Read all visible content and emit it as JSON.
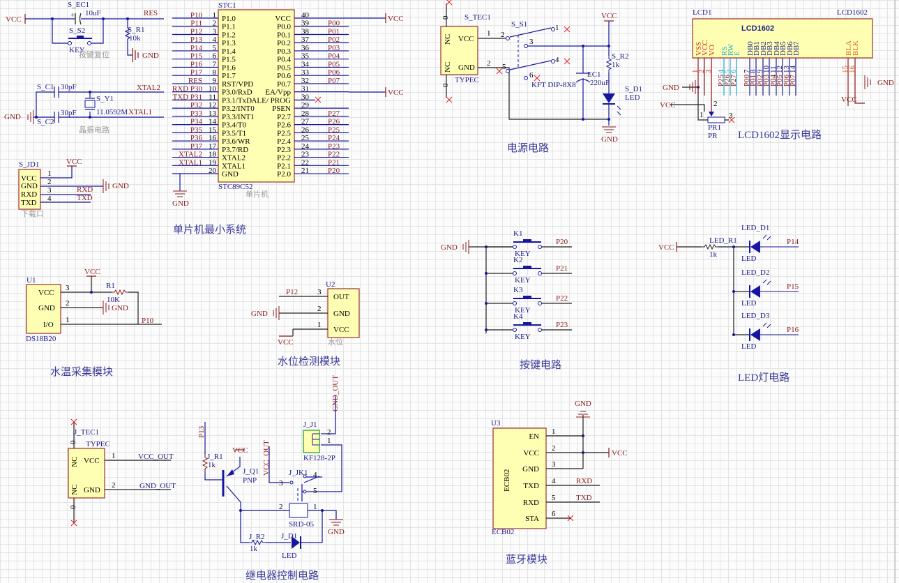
{
  "colors": {
    "wire": "#1616a0",
    "net": "#8b1a1a",
    "body": "#ffffb4",
    "body_border": "#a0302a",
    "caption": "#9a9a9a",
    "noconnect": "#e02020",
    "lcd_power": "#e02020",
    "lcd_ctrl": "#20a8c8",
    "lcd_data": "#20208c",
    "lcd_backlight": "#e06020"
  },
  "reset": {
    "vcc": "VCC",
    "cap_ref": "S_EC1",
    "cap_val": "10uF",
    "net": "RES",
    "sw_ref": "S_S2",
    "sw_val": "KEY",
    "caption": "按键复位",
    "r_ref": "S_R1",
    "r_val": "10k",
    "gnd": "GND"
  },
  "crystal": {
    "c1_ref": "S_C1",
    "c1_val": "30pF",
    "c2_ref": "S_C2",
    "c2_val": "30pF",
    "y_ref": "S_Y1",
    "y_val": "11.0592M",
    "net2": "XTAL2",
    "net1": "XTAL1",
    "gnd": "GND",
    "caption": "晶振电路"
  },
  "download": {
    "ref": "S_JD1",
    "vcc": "VCC",
    "gnd": "GND",
    "caption": "下载口",
    "pins": [
      {
        "num": "1",
        "name": "VCC",
        "net": ""
      },
      {
        "num": "2",
        "name": "GND",
        "net": ""
      },
      {
        "num": "3",
        "name": "RXD",
        "net": "RXD"
      },
      {
        "num": "4",
        "name": "TXD",
        "net": "TXD"
      }
    ]
  },
  "mcu": {
    "ref": "STC1",
    "part": "STC89C52",
    "caption": "单片机",
    "title": "单片机最小系统",
    "gnd": "GND",
    "vcc": "VCC",
    "vcc2": "VCC",
    "left_pins": [
      {
        "num": "1",
        "name": "P1.0",
        "net": "P10"
      },
      {
        "num": "2",
        "name": "P1.1",
        "net": "P11"
      },
      {
        "num": "3",
        "name": "P1.2",
        "net": "P12"
      },
      {
        "num": "4",
        "name": "P1.3",
        "net": "P13"
      },
      {
        "num": "5",
        "name": "P1.4",
        "net": "P14"
      },
      {
        "num": "6",
        "name": "P1.5",
        "net": "P15"
      },
      {
        "num": "7",
        "name": "P1.6",
        "net": "P16"
      },
      {
        "num": "8",
        "name": "P1.7",
        "net": "P17"
      },
      {
        "num": "9",
        "name": "RST/VPD",
        "net": "RES"
      },
      {
        "num": "10",
        "name": "P3.0/RxD",
        "net": "RXD P30"
      },
      {
        "num": "11",
        "name": "P3.1/TxD",
        "net": "TXD P31"
      },
      {
        "num": "12",
        "name": "P3.2/INT0",
        "net": "P32"
      },
      {
        "num": "13",
        "name": "P3.3/INT1",
        "net": "P33"
      },
      {
        "num": "14",
        "name": "P3.4/T0",
        "net": "P34"
      },
      {
        "num": "15",
        "name": "P3.5/T1",
        "net": "P35"
      },
      {
        "num": "16",
        "name": "P3.6/WR",
        "net": "P36"
      },
      {
        "num": "17",
        "name": "P3.7/RD",
        "net": "P37"
      },
      {
        "num": "18",
        "name": "XTAL2",
        "net": "XTAL2"
      },
      {
        "num": "19",
        "name": "XTAL1",
        "net": "XTAL1"
      },
      {
        "num": "20",
        "name": "GND",
        "net": ""
      }
    ],
    "right_pins": [
      {
        "num": "40",
        "name": "VCC",
        "net": ""
      },
      {
        "num": "39",
        "name": "P0.0",
        "net": "P00"
      },
      {
        "num": "38",
        "name": "P0.1",
        "net": "P01"
      },
      {
        "num": "37",
        "name": "P0.2",
        "net": "P02"
      },
      {
        "num": "36",
        "name": "P0.3",
        "net": "P03"
      },
      {
        "num": "35",
        "name": "P0.4",
        "net": "P04"
      },
      {
        "num": "34",
        "name": "P0.5",
        "net": "P05"
      },
      {
        "num": "33",
        "name": "P0.6",
        "net": "P06"
      },
      {
        "num": "32",
        "name": "P0.7",
        "net": "P07"
      },
      {
        "num": "31",
        "name": "EA/Vpp",
        "net": ""
      },
      {
        "num": "30",
        "name": "ALE/ PROG",
        "net": ""
      },
      {
        "num": "29",
        "name": "PSEN",
        "net": ""
      },
      {
        "num": "28",
        "name": "P2.7",
        "net": "P27"
      },
      {
        "num": "27",
        "name": "P2.6",
        "net": "P26"
      },
      {
        "num": "26",
        "name": "P2.5",
        "net": "P25"
      },
      {
        "num": "25",
        "name": "P2.4",
        "net": "P24"
      },
      {
        "num": "24",
        "name": "P2.3",
        "net": "P23"
      },
      {
        "num": "23",
        "name": "P2.2",
        "net": "P22"
      },
      {
        "num": "22",
        "name": "P2.1",
        "net": "P21"
      },
      {
        "num": "21",
        "name": "P2.0",
        "net": "P20"
      }
    ]
  },
  "power": {
    "title": "电源电路",
    "tec_ref": "S_TEC1",
    "tec_part": "TYPEC",
    "nc": "NC",
    "vcc_pin": "VCC",
    "gnd_pin": "GND",
    "zero": "0",
    "pin1": "1",
    "pin2": "2",
    "sw_ref": "S_S1",
    "sw_part": "KFT DIP-8X8",
    "sw_pins": [
      "1",
      "2",
      "3",
      "4",
      "5",
      "6"
    ],
    "vcc": "VCC",
    "gnd": "GND",
    "r_ref": "S_R2",
    "r_val": "1k",
    "c_ref": "EC1",
    "c_val": "220uF",
    "d_ref": "S_D1",
    "d_val": "LED"
  },
  "lcd": {
    "title": "LCD1602显示电路",
    "ref": "LCD1",
    "part": "LCD1602",
    "display": "LCD1602",
    "gnd": "GND",
    "vcc": "VCC",
    "gnd2": "GND",
    "vcc2": "VCC",
    "pot_ref": "PR1",
    "pot_val": "PR",
    "pins": [
      {
        "num": "1",
        "name": "VSS",
        "net": ""
      },
      {
        "num": "2",
        "name": "VCC",
        "net": ""
      },
      {
        "num": "3",
        "name": "VO",
        "net": ""
      },
      {
        "num": "4",
        "name": "RS",
        "net": "P25"
      },
      {
        "num": "5",
        "name": "RW",
        "net": "P26"
      },
      {
        "num": "6",
        "name": "E",
        "net": "P27"
      },
      {
        "num": "7",
        "name": "DB0",
        "net": "P00"
      },
      {
        "num": "8",
        "name": "DB1",
        "net": "P01"
      },
      {
        "num": "9",
        "name": "DB2",
        "net": "P02"
      },
      {
        "num": "10",
        "name": "DB3",
        "net": "P03"
      },
      {
        "num": "11",
        "name": "DB4",
        "net": "P04"
      },
      {
        "num": "12",
        "name": "DB5",
        "net": "P05"
      },
      {
        "num": "13",
        "name": "DB6",
        "net": "P06"
      },
      {
        "num": "14",
        "name": "DB7",
        "net": "P07"
      },
      {
        "num": "15",
        "name": "BLA",
        "net": ""
      },
      {
        "num": "16",
        "name": "BLK",
        "net": ""
      }
    ],
    "pot_pins": [
      "1",
      "2",
      "3"
    ]
  },
  "temp": {
    "title": "水温采集模块",
    "ref": "U1",
    "part": "DS18B20",
    "vcc": "VCC",
    "gnd": "GND",
    "r_ref": "R1",
    "r_val": "10K",
    "net": "P10",
    "pins": [
      {
        "num": "3",
        "name": "VCC"
      },
      {
        "num": "2",
        "name": "GND"
      },
      {
        "num": "1",
        "name": "I/O"
      }
    ]
  },
  "level": {
    "title": "水位检测模块",
    "ref": "U2",
    "caption": "水位",
    "net": "P12",
    "gnd": "GND",
    "vcc": "VCC",
    "pins": [
      {
        "num": "3",
        "name": "OUT"
      },
      {
        "num": "2",
        "name": "GND"
      },
      {
        "num": "1",
        "name": "VCC"
      }
    ]
  },
  "keys": {
    "title": "按键电路",
    "gnd": "GND",
    "items": [
      {
        "ref": "K1",
        "val": "KEY",
        "net": "P20"
      },
      {
        "ref": "K2",
        "val": "KEY",
        "net": "P21"
      },
      {
        "ref": "K3",
        "val": "KEY",
        "net": "P22"
      },
      {
        "ref": "K4",
        "val": "KEY",
        "net": "P23"
      }
    ]
  },
  "leds": {
    "title": "LED灯电路",
    "vcc": "VCC",
    "r_ref": "LED_R1",
    "r_val": "1k",
    "items": [
      {
        "ref": "LED_D1",
        "val": "LED",
        "net": "P14"
      },
      {
        "ref": "LED_D2",
        "val": "LED",
        "net": "P15"
      },
      {
        "ref": "LED_D3",
        "val": "LED",
        "net": "P16"
      }
    ]
  },
  "usb": {
    "ref": "J_TEC1",
    "part": "TYPEC",
    "nc": "NC",
    "vcc_pin": "VCC",
    "gnd_pin": "GND",
    "zero": "0",
    "pin1": "1",
    "pin2": "2",
    "net1": "VCC_OUT",
    "net2": "GND_OUT"
  },
  "relay": {
    "title": "继电器控制电路",
    "net_in": "P13",
    "r1_ref": "J_R1",
    "r1_val": "1k",
    "vcc": "VCC",
    "q_ref": "J_Q1",
    "q_val": "PNP",
    "vcc_out": "VCC_OUT",
    "gnd_out": "GND_OUT",
    "j_ref": "J_J1",
    "j_part": "KF128-2P",
    "j_pins": [
      "2",
      "1"
    ],
    "k_ref": "J_JK1",
    "k_part": "SRD-05",
    "k_pins": [
      "3",
      "4",
      "5",
      "2",
      "1"
    ],
    "gnd": "GND",
    "r2_ref": "J_R2",
    "r2_val": "1k",
    "d_ref": "J_D1",
    "d_val": "LED"
  },
  "bt": {
    "title": "蓝牙模块",
    "ref": "U3",
    "part": "ECB02",
    "gnd": "GND",
    "vcc": "VCC",
    "rxd": "RXD",
    "txd": "TXD",
    "pins": [
      {
        "num": "1",
        "name": "EN"
      },
      {
        "num": "2",
        "name": "VCC"
      },
      {
        "num": "3",
        "name": "GND"
      },
      {
        "num": "4",
        "name": "TXD"
      },
      {
        "num": "5",
        "name": "RXD"
      },
      {
        "num": "6",
        "name": "STA"
      }
    ]
  }
}
